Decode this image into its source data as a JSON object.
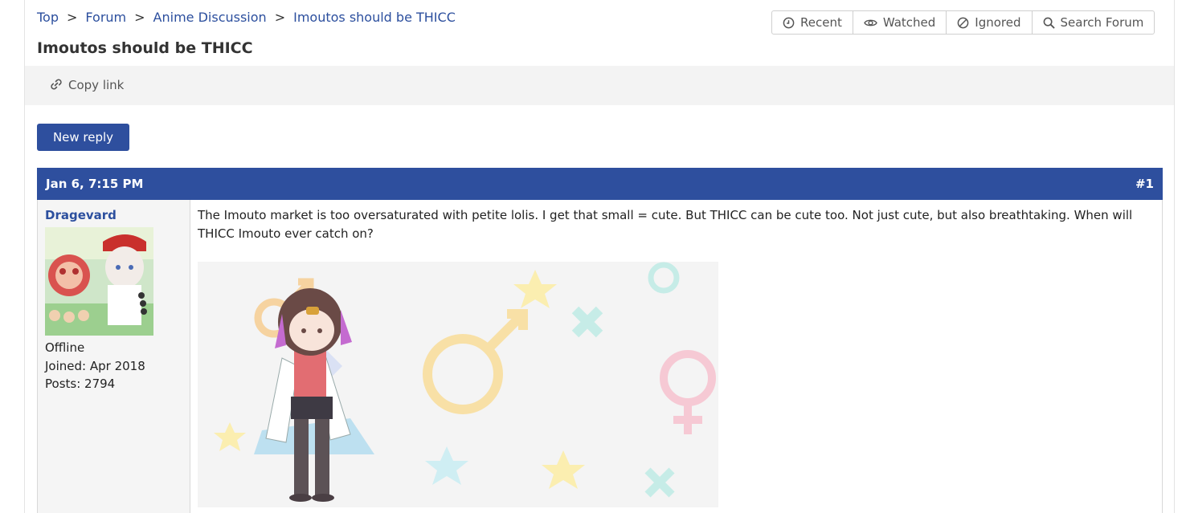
{
  "breadcrumb": {
    "items": [
      "Top",
      "Forum",
      "Anime Discussion",
      "Imoutos should be THICC"
    ],
    "separator": ">"
  },
  "thread": {
    "title": "Imoutos should be THICC"
  },
  "forum_nav": {
    "recent": "Recent",
    "watched": "Watched",
    "ignored": "Ignored",
    "search": "Search Forum"
  },
  "toolbar": {
    "copy_link": "Copy link"
  },
  "actions": {
    "new_reply": "New reply"
  },
  "post": {
    "date": "Jan 6, 7:15 PM",
    "number": "#1",
    "author": {
      "username": "Dragevard",
      "status": "Offline",
      "joined": "Joined: Apr 2018",
      "posts": "Posts: 2794"
    },
    "text": "The Imouto market is too oversaturated with petite lolis. I get that small = cute. But THICC can be cute too. Not just cute, but also breathtaking. When will THICC Imouto ever catch on?"
  },
  "colors": {
    "accent": "#2e4f9e",
    "link": "#2c4f9e",
    "toolbar_bg": "#f3f3f3",
    "sidebar_bg": "#f5f5f5"
  }
}
